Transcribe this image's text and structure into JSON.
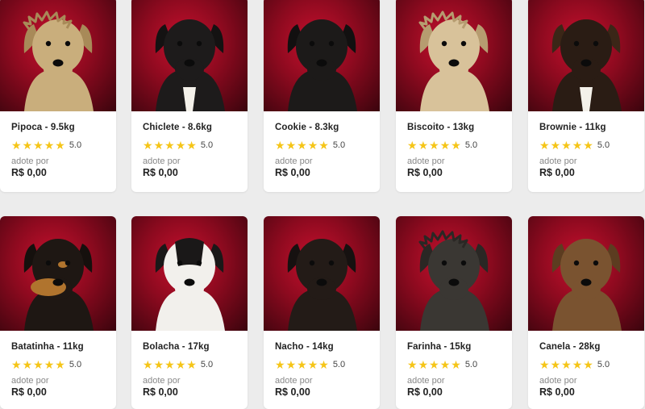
{
  "colors": {
    "star": "#f5c518",
    "photo_bg": "#a50d25"
  },
  "cards": [
    {
      "name": "Pipoca - 9.5kg",
      "rating": 5,
      "rating_label": "5.0",
      "adopt_label": "adote por",
      "price": "R$ 0,00",
      "fur": "#c9ae7c",
      "ear": "#a88a58",
      "style": "shaggy"
    },
    {
      "name": "Chiclete - 8.6kg",
      "rating": 5,
      "rating_label": "5.0",
      "adopt_label": "adote por",
      "price": "R$ 0,00",
      "fur": "#1d1b1b",
      "ear": "#141212",
      "style": "chest"
    },
    {
      "name": "Cookie - 8.3kg",
      "rating": 5,
      "rating_label": "5.0",
      "adopt_label": "adote por",
      "price": "R$ 0,00",
      "fur": "#1c1a19",
      "ear": "#121010",
      "style": "plain"
    },
    {
      "name": "Biscoito - 13kg",
      "rating": 5,
      "rating_label": "5.0",
      "adopt_label": "adote por",
      "price": "R$ 0,00",
      "fur": "#d8c29a",
      "ear": "#b69c70",
      "style": "shaggy"
    },
    {
      "name": "Brownie - 11kg",
      "rating": 5,
      "rating_label": "5.0",
      "adopt_label": "adote por",
      "price": "R$ 0,00",
      "fur": "#2a1c14",
      "ear": "#3b2617",
      "style": "chest"
    },
    {
      "name": "Batatinha - 11kg",
      "rating": 5,
      "rating_label": "5.0",
      "adopt_label": "adote por",
      "price": "R$ 0,00",
      "fur": "#1e1713",
      "ear": "#15100d",
      "style": "tan"
    },
    {
      "name": "Bolacha - 17kg",
      "rating": 5,
      "rating_label": "5.0",
      "adopt_label": "adote por",
      "price": "R$ 0,00",
      "fur": "#f2f0ec",
      "ear": "#1a1818",
      "style": "piebald"
    },
    {
      "name": "Nacho - 14kg",
      "rating": 5,
      "rating_label": "5.0",
      "adopt_label": "adote por",
      "price": "R$ 0,00",
      "fur": "#231b17",
      "ear": "#161110",
      "style": "plain"
    },
    {
      "name": "Farinha - 15kg",
      "rating": 5,
      "rating_label": "5.0",
      "adopt_label": "adote por",
      "price": "R$ 0,00",
      "fur": "#3a3733",
      "ear": "#2a2724",
      "style": "shaggy"
    },
    {
      "name": "Canela - 28kg",
      "rating": 5,
      "rating_label": "5.0",
      "adopt_label": "adote por",
      "price": "R$ 0,00",
      "fur": "#7a5330",
      "ear": "#5c3c20",
      "style": "plain"
    }
  ]
}
